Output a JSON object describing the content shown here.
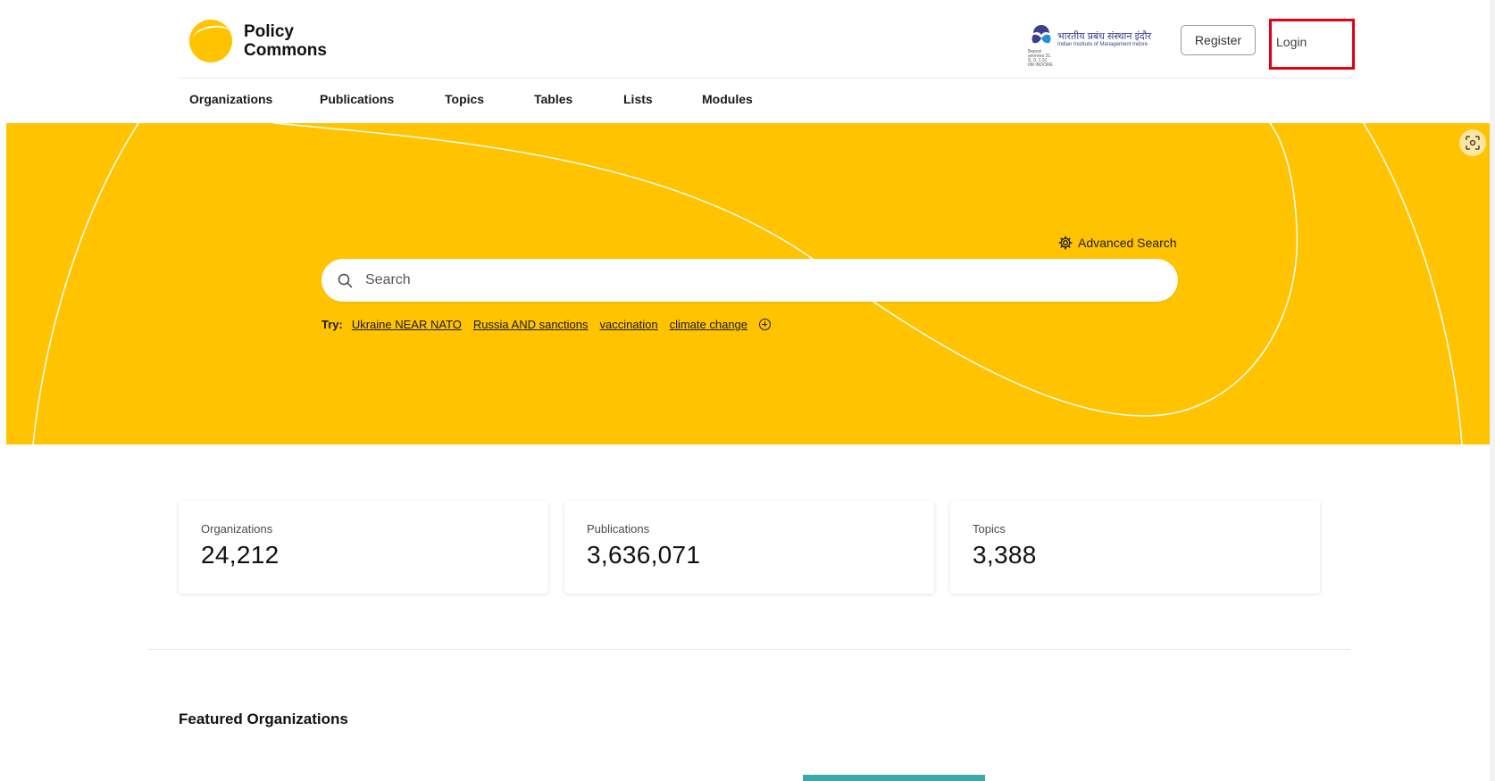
{
  "brand": {
    "line1": "Policy",
    "line2": "Commons"
  },
  "institution": {
    "name_hi": "भारतीय प्रबंध संस्थान इंदौर",
    "name_en": "Indian Institute of Management Indore",
    "small_text": "Bepozi sennrea 31. S. 0. 1:31 IIM INDORE"
  },
  "header": {
    "register_label": "Register",
    "login_label": "Login"
  },
  "nav": {
    "items": [
      {
        "label": "Organizations"
      },
      {
        "label": "Publications"
      },
      {
        "label": "Topics"
      },
      {
        "label": "Tables"
      },
      {
        "label": "Lists"
      },
      {
        "label": "Modules"
      }
    ]
  },
  "hero": {
    "advanced_search_label": "Advanced Search",
    "search_placeholder": "Search",
    "try_label": "Try:",
    "try_links": [
      {
        "label": "Ukraine NEAR NATO"
      },
      {
        "label": "Russia AND sanctions"
      },
      {
        "label": "vaccination"
      },
      {
        "label": "climate change"
      }
    ]
  },
  "stats": [
    {
      "label": "Organizations",
      "value": "24,212"
    },
    {
      "label": "Publications",
      "value": "3,636,071"
    },
    {
      "label": "Topics",
      "value": "3,388"
    }
  ],
  "featured": {
    "title": "Featured Organizations"
  },
  "colors": {
    "accent": "#ffc300",
    "highlight_border": "#e60012",
    "featured_strip": "#3aa9a9"
  }
}
